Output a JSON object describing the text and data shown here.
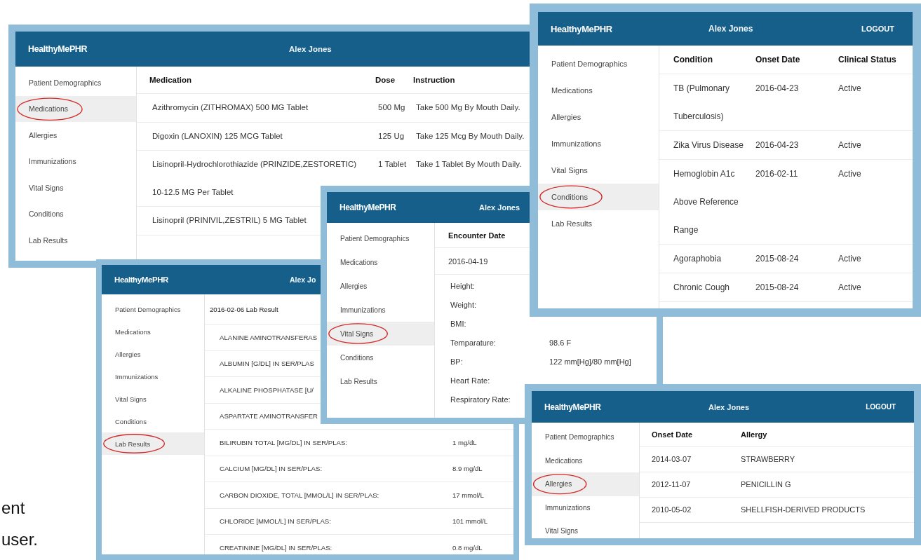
{
  "slide_text": [
    "ent",
    "user."
  ],
  "windows": [
    {
      "app_title": "HealthyMePHR",
      "user": "Alex Jones",
      "nav": [
        {
          "label": "Patient Demographics",
          "selected": false
        },
        {
          "label": "Medications",
          "selected": true
        },
        {
          "label": "Allergies",
          "selected": false
        },
        {
          "label": "Immunizations",
          "selected": false
        },
        {
          "label": "Vital Signs",
          "selected": false
        },
        {
          "label": "Conditions",
          "selected": false
        },
        {
          "label": "Lab Results",
          "selected": false
        }
      ],
      "content": {
        "kind": "table",
        "columns": [
          "Medication",
          "Dose",
          "Instruction"
        ],
        "rows": [
          {
            "cells": [
              "Azithromycin (ZITHROMAX) 500 MG Tablet",
              "500 Mg",
              "Take 500 Mg By Mouth Daily."
            ]
          },
          {
            "cells": [
              "Digoxin (LANOXIN) 125 MCG Tablet",
              "125 Ug",
              "Take 125 Mcg By Mouth Daily."
            ]
          },
          {
            "cells": [
              [
                "Lisinopril-Hydrochlorothiazide (PRINZIDE,ZESTORETIC)",
                "10-12.5 MG Per Tablet"
              ],
              "1 Tablet",
              "Take 1 Tablet By Mouth Daily."
            ]
          },
          {
            "cells": [
              "Lisinopril (PRINIVIL,ZESTRIL) 5 MG Tablet"
            ]
          }
        ]
      }
    },
    {
      "app_title": "HealthyMePHR",
      "user": "Alex Jones",
      "logout": "LOGOUT",
      "nav": [
        {
          "label": "Patient Demographics",
          "selected": false
        },
        {
          "label": "Medications",
          "selected": false
        },
        {
          "label": "Allergies",
          "selected": false
        },
        {
          "label": "Immunizations",
          "selected": false
        },
        {
          "label": "Vital Signs",
          "selected": false
        },
        {
          "label": "Conditions",
          "selected": true
        },
        {
          "label": "Lab Results",
          "selected": false
        }
      ],
      "content": {
        "kind": "table",
        "columns": [
          "Condition",
          "Onset Date",
          "Clinical Status"
        ],
        "rows": [
          {
            "cells": [
              [
                "TB (Pulmonary",
                "Tuberculosis)"
              ],
              "2016-04-23",
              "Active"
            ]
          },
          {
            "cells": [
              "Zika Virus Disease",
              "2016-04-23",
              "Active"
            ]
          },
          {
            "cells": [
              [
                "Hemoglobin A1c",
                "Above Reference",
                "Range"
              ],
              "2016-02-11",
              "Active"
            ]
          },
          {
            "cells": [
              "Agoraphobia",
              "2015-08-24",
              "Active"
            ]
          },
          {
            "cells": [
              "Chronic Cough",
              "2015-08-24",
              "Active"
            ]
          }
        ]
      }
    },
    {
      "app_title": "HealthyMePHR",
      "user": "Alex Jo",
      "nav": [
        {
          "label": "Patient Demographics",
          "selected": false
        },
        {
          "label": "Medications",
          "selected": false
        },
        {
          "label": "Allergies",
          "selected": false
        },
        {
          "label": "Immunizations",
          "selected": false
        },
        {
          "label": "Vital Signs",
          "selected": false
        },
        {
          "label": "Conditions",
          "selected": false
        },
        {
          "label": "Lab Results",
          "selected": true
        }
      ],
      "content": {
        "kind": "lab_results",
        "title": "2016-02-06 Lab Result",
        "rows": [
          {
            "test": "ALANINE AMINOTRANSFERAS"
          },
          {
            "test": "ALBUMIN [G/DL] IN SER/PLAS"
          },
          {
            "test": "ALKALINE PHOSPHATASE [U/"
          },
          {
            "test": "ASPARTATE AMINOTRANSFER"
          },
          {
            "test": "BILIRUBIN TOTAL [MG/DL] IN SER/PLAS:",
            "value": "1 mg/dL"
          },
          {
            "test": "CALCIUM [MG/DL] IN SER/PLAS:",
            "value": "8.9 mg/dL"
          },
          {
            "test": "CARBON DIOXIDE, TOTAL [MMOL/L] IN SER/PLAS:",
            "value": "17 mmol/L"
          },
          {
            "test": "CHLORIDE [MMOL/L] IN SER/PLAS:",
            "value": "101 mmol/L"
          },
          {
            "test": "CREATININE [MG/DL] IN SER/PLAS:",
            "value": "0.8 mg/dL"
          }
        ]
      }
    },
    {
      "app_title": "HealthyMePHR",
      "user": "Alex Jones",
      "nav": [
        {
          "label": "Patient Demographics",
          "selected": false
        },
        {
          "label": "Medications",
          "selected": false
        },
        {
          "label": "Allergies",
          "selected": false
        },
        {
          "label": "Immunizations",
          "selected": false
        },
        {
          "label": "Vital Signs",
          "selected": true
        },
        {
          "label": "Conditions",
          "selected": false
        },
        {
          "label": "Lab Results",
          "selected": false
        }
      ],
      "content": {
        "kind": "vitals",
        "column": "Encounter Date",
        "date": "2016-04-19",
        "rows": [
          {
            "label": "Height:"
          },
          {
            "label": "Weight:"
          },
          {
            "label": "BMI:"
          },
          {
            "label": "Temparature:",
            "value": "98.6 F"
          },
          {
            "label": "BP:",
            "value": "122 mm[Hg]/80 mm[Hg]"
          },
          {
            "label": "Heart Rate:"
          },
          {
            "label": "Respiratory Rate:"
          }
        ]
      }
    },
    {
      "app_title": "HealthyMePHR",
      "user": "Alex Jones",
      "logout": "LOGOUT",
      "nav": [
        {
          "label": "Patient Demographics",
          "selected": false
        },
        {
          "label": "Medications",
          "selected": false
        },
        {
          "label": "Allergies",
          "selected": true
        },
        {
          "label": "Immunizations",
          "selected": false
        },
        {
          "label": "Vital Signs",
          "selected": false
        }
      ],
      "content": {
        "kind": "table",
        "columns": [
          "Onset Date",
          "Allergy"
        ],
        "rows": [
          {
            "cells": [
              "2014-03-07",
              "STRAWBERRY"
            ]
          },
          {
            "cells": [
              "2012-11-07",
              "PENICILLIN G"
            ]
          },
          {
            "cells": [
              "2010-05-02",
              "SHELLFISH-DERIVED PRODUCTS"
            ]
          }
        ]
      }
    }
  ]
}
